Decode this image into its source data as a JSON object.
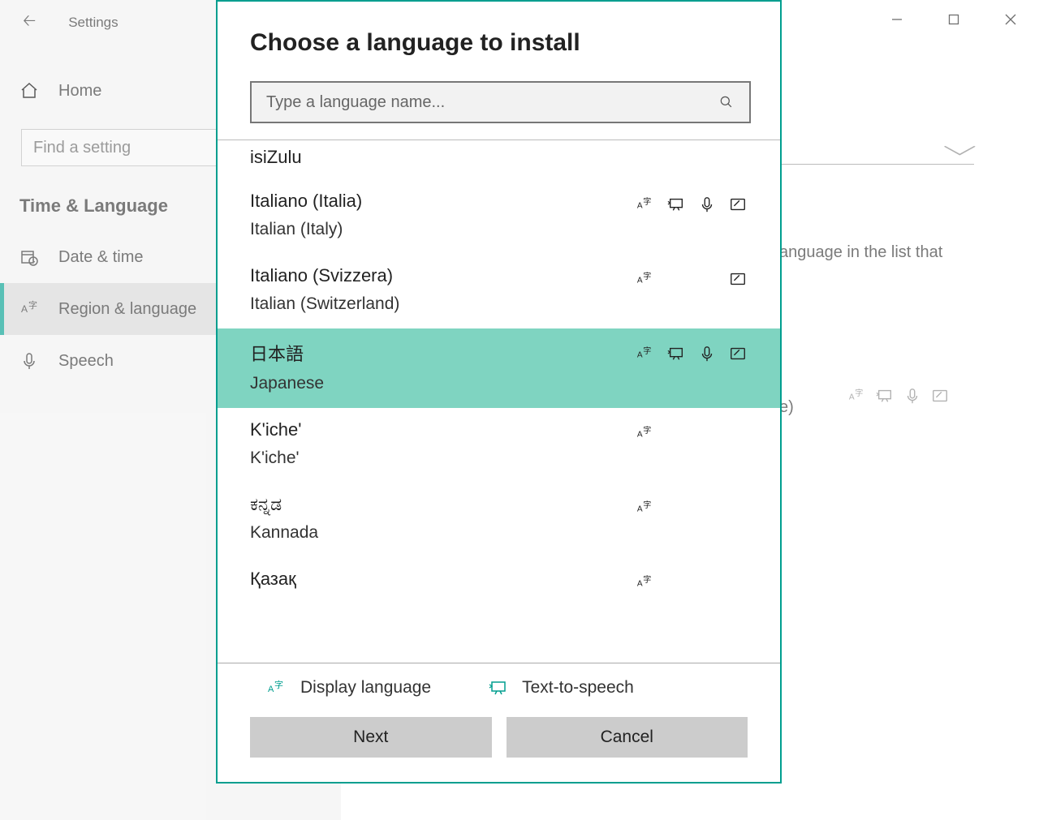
{
  "settings": {
    "title": "Settings",
    "home": "Home",
    "search_placeholder": "Find a setting",
    "section": "Time & Language",
    "items": [
      {
        "label": "Date & time"
      },
      {
        "label": "Region & language"
      },
      {
        "label": "Speech"
      }
    ]
  },
  "background": {
    "hint_text": "anguage in the list that",
    "suffix_text": "e)"
  },
  "modal": {
    "title": "Choose a language to install",
    "search_placeholder": "Type a language name...",
    "languages": [
      {
        "native": "isiZulu",
        "english": "",
        "single": true,
        "features": []
      },
      {
        "native": "Italiano (Italia)",
        "english": "Italian (Italy)",
        "features": [
          "display",
          "tts",
          "speech",
          "handwriting"
        ]
      },
      {
        "native": "Italiano (Svizzera)",
        "english": "Italian (Switzerland)",
        "features": [
          "display",
          "handwriting"
        ]
      },
      {
        "native": "日本語",
        "english": "Japanese",
        "selected": true,
        "features": [
          "display",
          "tts",
          "speech",
          "handwriting"
        ]
      },
      {
        "native": "K'iche'",
        "english": "K'iche'",
        "features": [
          "display"
        ]
      },
      {
        "native": "ಕನ್ನಡ",
        "english": "Kannada",
        "features": [
          "display"
        ]
      },
      {
        "native": "Қазақ",
        "english": "",
        "cut": true,
        "features": [
          "display"
        ]
      }
    ],
    "legend": {
      "display": "Display language",
      "tts": "Text-to-speech"
    },
    "buttons": {
      "next": "Next",
      "cancel": "Cancel"
    }
  }
}
